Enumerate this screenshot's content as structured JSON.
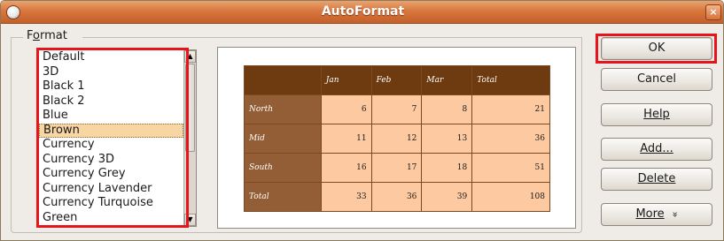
{
  "window": {
    "title": "AutoFormat",
    "close_glyph": "×"
  },
  "format_group": {
    "label": "Format",
    "mnemonic": "o"
  },
  "format_list": {
    "items": [
      "Default",
      "3D",
      "Black 1",
      "Black 2",
      "Blue",
      "Brown",
      "Currency",
      "Currency 3D",
      "Currency Grey",
      "Currency Lavender",
      "Currency Turquoise",
      "Green"
    ],
    "selected": "Brown"
  },
  "preview_table": {
    "columns": [
      "",
      "Jan",
      "Feb",
      "Mar",
      "Total"
    ],
    "rows": [
      {
        "label": "North",
        "values": [
          "6",
          "7",
          "8",
          "21"
        ]
      },
      {
        "label": "Mid",
        "values": [
          "11",
          "12",
          "13",
          "36"
        ]
      },
      {
        "label": "South",
        "values": [
          "16",
          "17",
          "18",
          "51"
        ]
      },
      {
        "label": "Total",
        "values": [
          "33",
          "36",
          "39",
          "108"
        ]
      }
    ],
    "colors": {
      "header": "#6e3a10",
      "row_header": "#935e35",
      "cell": "#fdc9a1"
    }
  },
  "buttons": {
    "ok": "OK",
    "cancel": "Cancel",
    "help": "Help",
    "add": "Add...",
    "delete": "Delete",
    "more": "More",
    "more_icon": "double-chevron-down-icon"
  },
  "highlight_color": "#e8141c"
}
